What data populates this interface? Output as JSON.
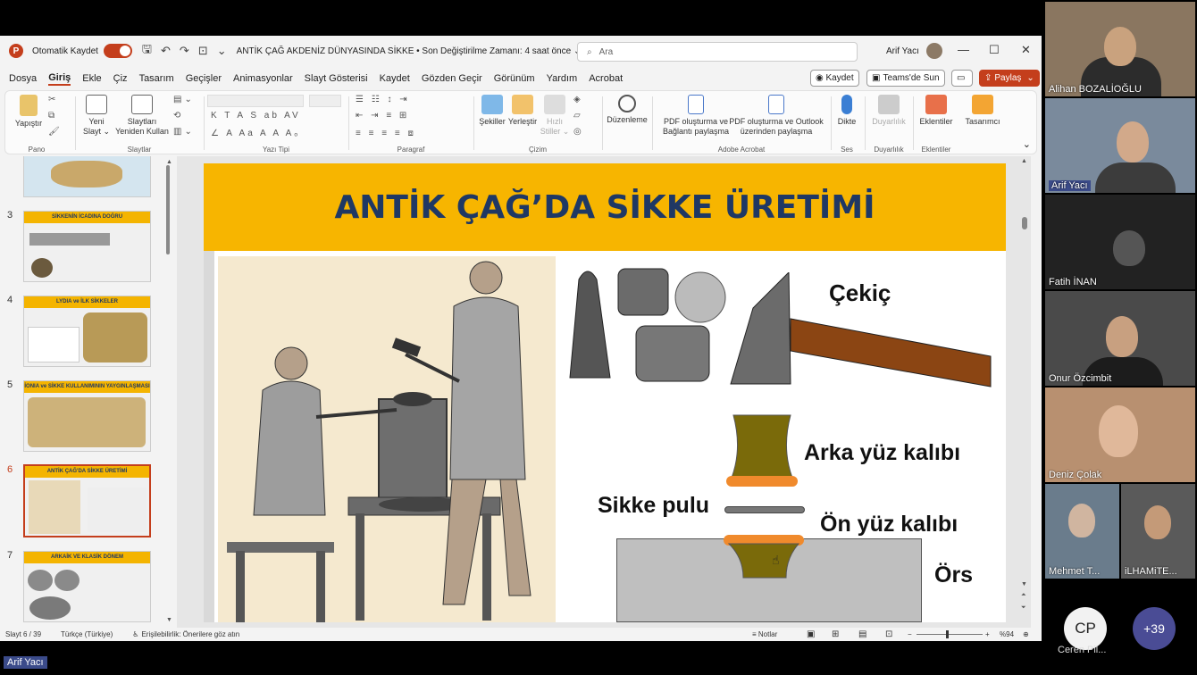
{
  "app": {
    "autosave_label": "Otomatik Kaydet",
    "doc_title": "ANTİK ÇAĞ AKDENİZ DÜNYASINDA SİKKE • Son Değiştirilme Zamanı: 4 saat önce ⌄",
    "search_placeholder": "Ara",
    "user_name": "Arif Yacı"
  },
  "menu": [
    "Dosya",
    "Giriş",
    "Ekle",
    "Çiz",
    "Tasarım",
    "Geçişler",
    "Animasyonlar",
    "Slayt Gösterisi",
    "Kaydet",
    "Gözden Geçir",
    "Görünüm",
    "Yardım",
    "Acrobat"
  ],
  "menu_actions": {
    "record": "◉ Kaydet",
    "teams": "Teams'de Sun",
    "share": "Paylaş"
  },
  "ribbon": {
    "paste": "Yapıştır",
    "pano": "Pano",
    "new_slide_1": "Yeni",
    "new_slide_2": "Slayt ⌄",
    "reuse_1": "Slaytları",
    "reuse_2": "Yeniden Kullan",
    "slides_group": "Slaytlar",
    "font_group": "Yazı Tipi",
    "paragraph_group": "Paragraf",
    "shapes": "Şekiller",
    "arrange": "Yerleştir",
    "quick_styles_1": "Hızlı",
    "quick_styles_2": "Stiller ⌄",
    "drawing_group": "Çizim",
    "editing": "Düzenleme",
    "pdf_link_1": "PDF oluşturma ve",
    "pdf_link_2": "Bağlantı paylaşma",
    "pdf_outlook_1": "PDF oluşturma ve Outlook",
    "pdf_outlook_2": "üzerinden paylaşma",
    "acrobat_group": "Adobe Acrobat",
    "dictate": "Dikte",
    "voice_group": "Ses",
    "sensitivity": "Duyarlılık",
    "sensitivity_group": "Duyarlılık",
    "addins": "Eklentiler",
    "addins_group": "Eklentiler",
    "designer": "Tasarımcı"
  },
  "thumbnails": [
    {
      "num": "3",
      "title": "SİKKENİN İCADINA DOĞRU"
    },
    {
      "num": "4",
      "title": "LYDIA ve İLK SİKKELER"
    },
    {
      "num": "5",
      "title": "İONIA ve SİKKE KULLANIMININ YAYGINLAŞMASI"
    },
    {
      "num": "6",
      "title": "ANTİK ÇAĞ'DA SİKKE ÜRETİMİ"
    },
    {
      "num": "7",
      "title": "ARKAİK VE KLASİK DÖNEM"
    }
  ],
  "slide": {
    "title": "ANTİK ÇAĞ’DA SİKKE ÜRETİMİ",
    "label_hammer": "Çekiç",
    "label_upper_die": "Arka yüz kalıbı",
    "label_blank": "Sikke pulu",
    "label_lower_die": "Ön yüz kalıbı",
    "label_anvil": "Örs"
  },
  "status": {
    "slide": "Slayt 6 / 39",
    "language": "Türkçe (Türkiye)",
    "accessibility": "Erişilebilirlik: Önerilere göz atın",
    "notes": "Notlar",
    "zoom": "%94"
  },
  "participants": [
    {
      "name": "Alihan BOZALİOĞLU"
    },
    {
      "name": "Arif Yacı"
    },
    {
      "name": "Fatih İNAN"
    },
    {
      "name": "Onur Özcimbit"
    },
    {
      "name": "Deniz Çolak"
    },
    {
      "name": "Mehmet T..."
    },
    {
      "name": "iLHAMiTE..."
    }
  ],
  "extra_participants": {
    "initials": "CP",
    "name": "Ceren Pil...",
    "more": "+39"
  },
  "presenter_label": "Arif Yacı",
  "colors": {
    "accent": "#c43e1c",
    "slide_title_bg": "#f7b500",
    "slide_title_text": "#1f3864",
    "die_color": "#7a6a0a",
    "die_face": "#f08a2c"
  }
}
